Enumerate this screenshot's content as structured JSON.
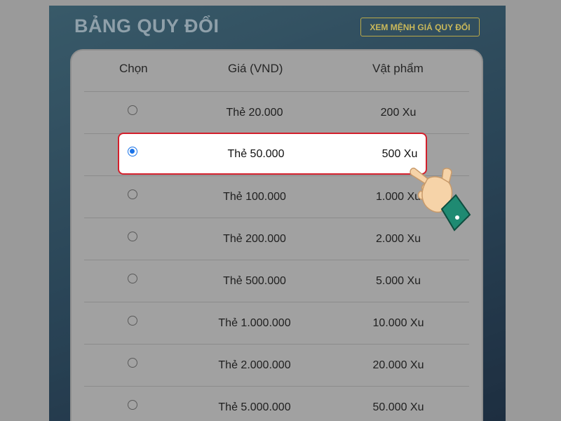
{
  "header": {
    "title": "BẢNG QUY ĐỔI",
    "view_denominations_label": "XEM MỆNH GIÁ QUY ĐỔI"
  },
  "table": {
    "columns": [
      "Chọn",
      "Giá (VND)",
      "Vật phẩm"
    ],
    "selected_index": 1,
    "rows": [
      {
        "price": "Thẻ 20.000",
        "item": "200 Xu"
      },
      {
        "price": "Thẻ 50.000",
        "item": "500 Xu"
      },
      {
        "price": "Thẻ 100.000",
        "item": "1.000 Xu"
      },
      {
        "price": "Thẻ 200.000",
        "item": "2.000 Xu"
      },
      {
        "price": "Thẻ 500.000",
        "item": "5.000 Xu"
      },
      {
        "price": "Thẻ 1.000.000",
        "item": "10.000 Xu"
      },
      {
        "price": "Thẻ 2.000.000",
        "item": "20.000 Xu"
      },
      {
        "price": "Thẻ 5.000.000",
        "item": "50.000 Xu"
      }
    ]
  },
  "colors": {
    "highlight_border": "#d31f2b",
    "radio_selected": "#1a73e8",
    "button_text": "#c9b85a"
  },
  "icons": {
    "pointer": "pointing-hand-icon"
  }
}
